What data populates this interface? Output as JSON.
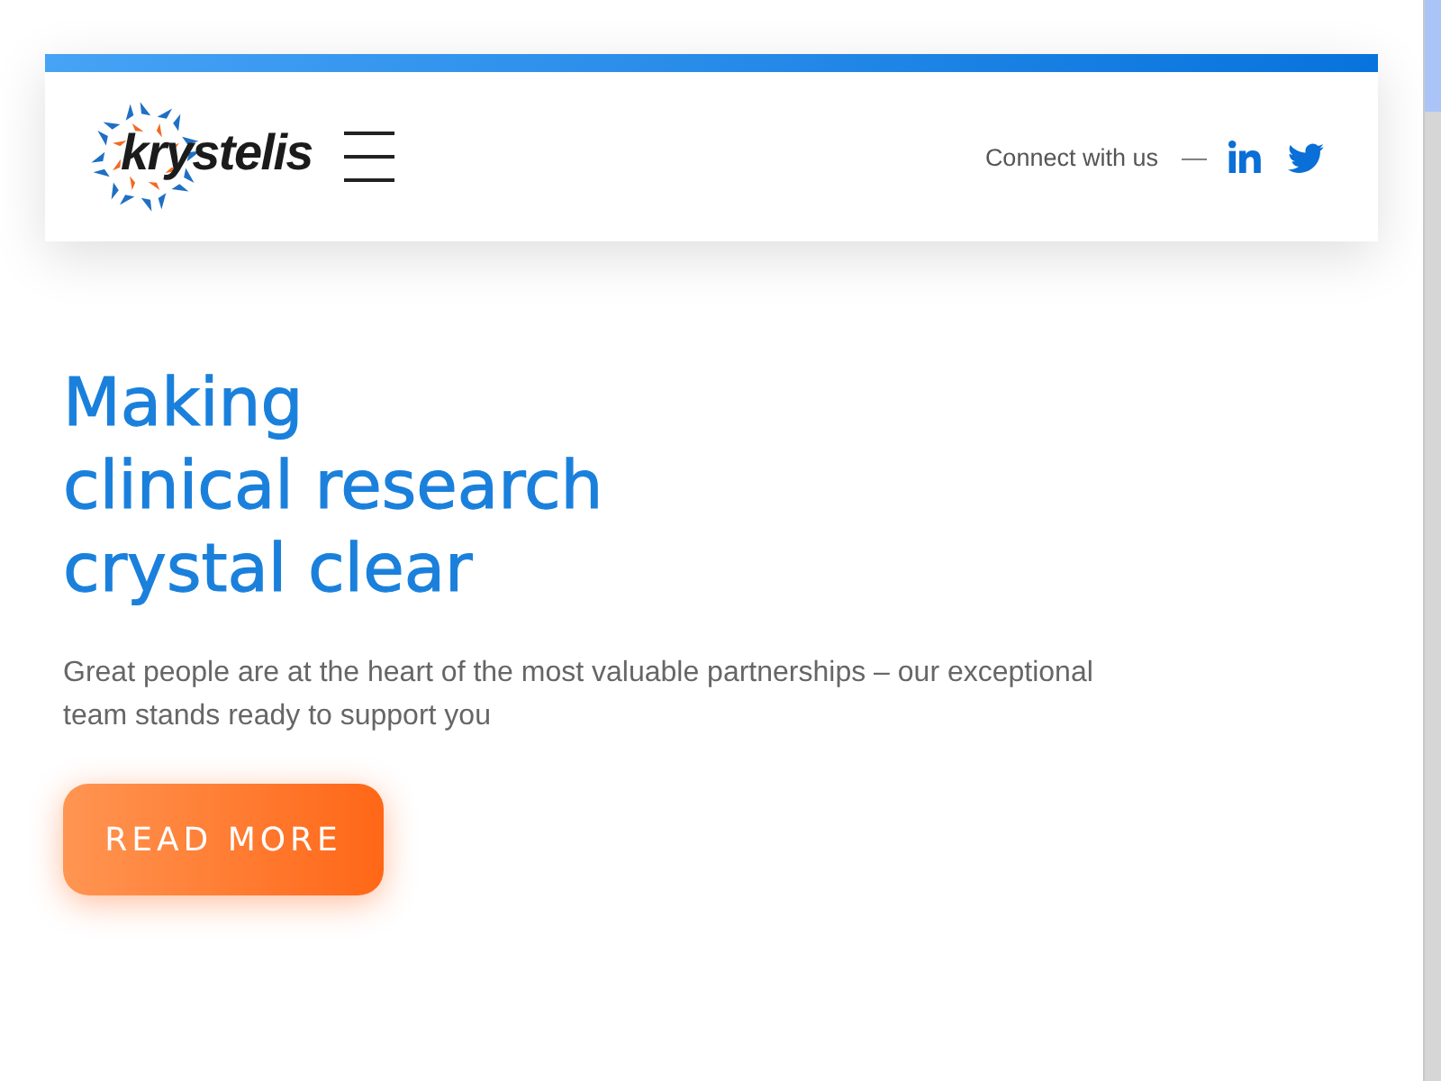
{
  "header": {
    "logo_text": "krystelis",
    "social_label": "Connect with us",
    "separator": "—"
  },
  "hero": {
    "heading_lines": [
      "Making",
      "clinical research",
      "crystal clear"
    ],
    "description": "Great people are at the heart of the most valuable partnerships – our exceptional team stands ready to support you",
    "button": "READ MORE"
  }
}
